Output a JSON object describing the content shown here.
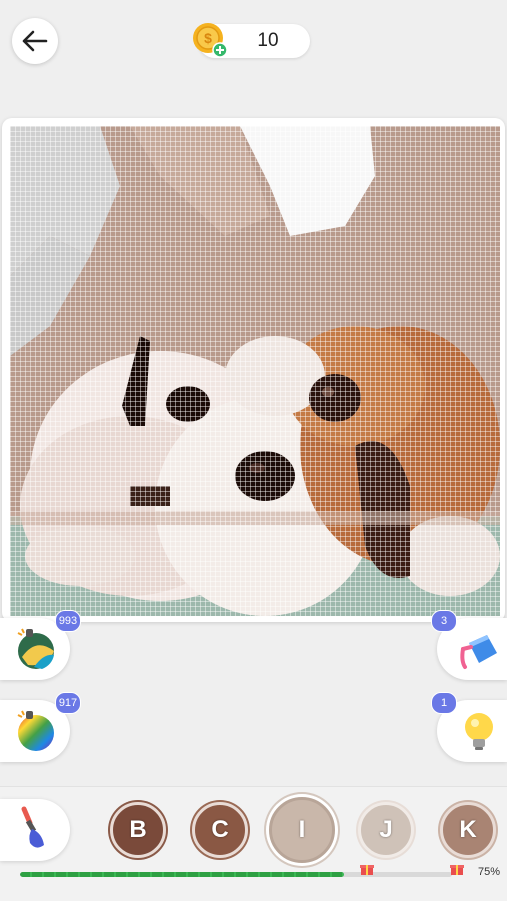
{
  "header": {
    "back_icon": "arrow-left-icon",
    "coins": "10",
    "coin_icon": "coin-plus-icon"
  },
  "tools": {
    "bomb": {
      "icon": "color-bomb-icon",
      "count": "993"
    },
    "rainbow_bomb": {
      "icon": "rainbow-bomb-icon",
      "count": "917"
    },
    "bucket": {
      "icon": "paint-bucket-icon",
      "count": "3"
    },
    "hint": {
      "icon": "lightbulb-icon",
      "count": "1"
    }
  },
  "palette": [
    {
      "letter": "B",
      "color": "#7a4a3a"
    },
    {
      "letter": "C",
      "color": "#8a5844"
    },
    {
      "letter": "I",
      "color": "#c9b7aa",
      "selected": true
    },
    {
      "letter": "J",
      "color": "#cfc2b8"
    },
    {
      "letter": "K",
      "color": "#a98473"
    }
  ],
  "progress": {
    "fraction": 0.75,
    "label": "75%"
  },
  "brush_icon": "paintbrush-icon"
}
